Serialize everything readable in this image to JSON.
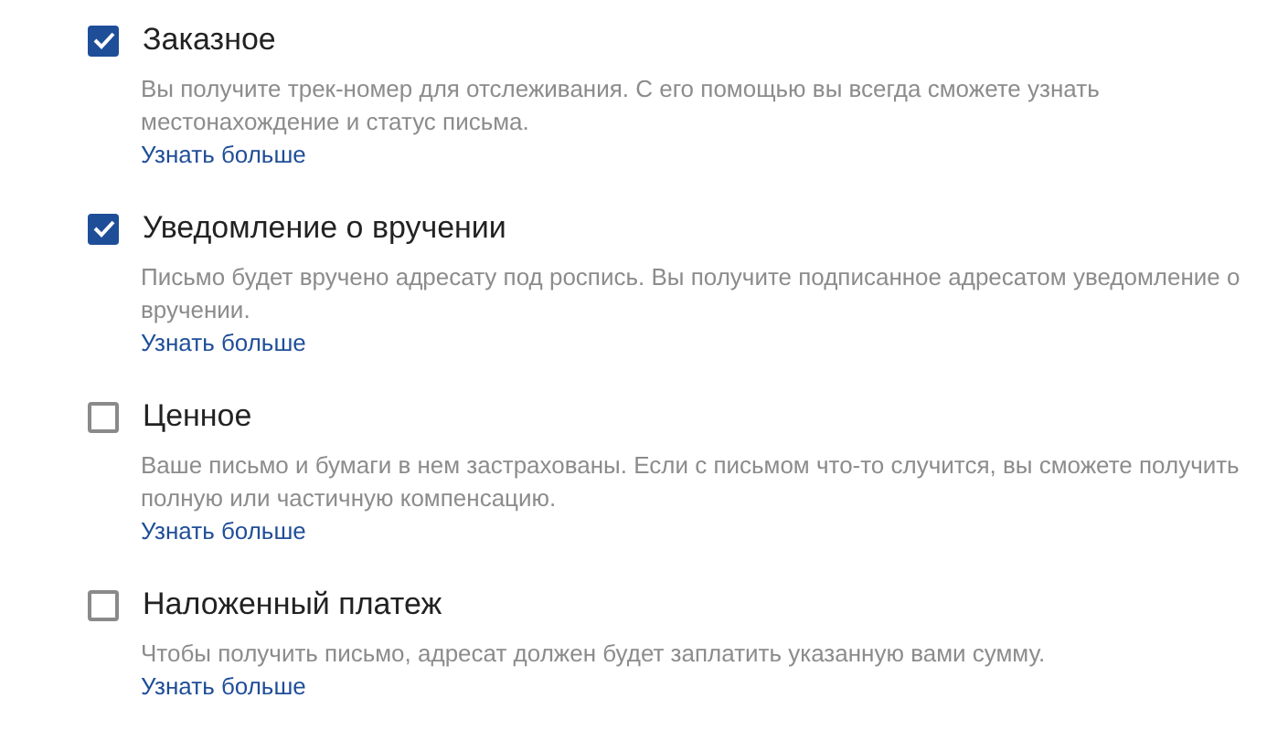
{
  "options": [
    {
      "label": "Заказное",
      "checked": true,
      "description": "Вы получите трек-номер для отслеживания. С его помощью вы всегда сможете узнать местонахождение и статус письма.",
      "link": "Узнать больше"
    },
    {
      "label": "Уведомление о вручении",
      "checked": true,
      "description": "Письмо будет вручено адресату под роспись. Вы получите подписанное адресатом уведомление о вручении.",
      "link": "Узнать больше"
    },
    {
      "label": "Ценное",
      "checked": false,
      "description": "Ваше письмо и бумаги в нем застрахованы. Если с письмом что-то случится, вы сможете получить полную или частичную компенсацию.",
      "link": "Узнать больше"
    },
    {
      "label": "Наложенный платеж",
      "checked": false,
      "description": "Чтобы получить письмо, адресат должен будет заплатить указанную вами сумму.",
      "link": "Узнать больше"
    }
  ]
}
